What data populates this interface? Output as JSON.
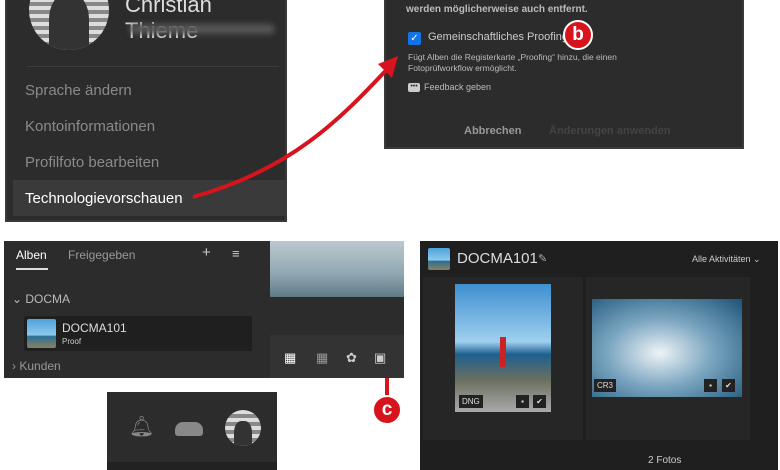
{
  "profile": {
    "name": "Christian Thieme",
    "menu": [
      "Sprache ändern",
      "Kontoinformationen",
      "Profilfoto bearbeiten",
      "Technologievorschauen"
    ]
  },
  "dialog": {
    "top_text": "werden möglicherweise auch entfernt.",
    "checkbox_label": "Gemeinschaftliches Proofing",
    "description": "Fügt Alben die Registerkarte „Proofing“ hinzu, die einen Fotoprüfworkflow ermöglicht.",
    "feedback": "Feedback geben",
    "cancel": "Abbrechen",
    "apply": "Änderungen anwenden"
  },
  "badges": {
    "b": "b",
    "c": "c"
  },
  "albums": {
    "tabs": [
      "Alben",
      "Freigegeben"
    ],
    "add": "+",
    "sort": "≡",
    "group": "DOCMA",
    "album_name": "DOCMA101",
    "album_sub": "Proof",
    "group2": "Kunden"
  },
  "view": {
    "title": "DOCMA101",
    "filter": "Alle Aktivitäten",
    "photos": [
      {
        "type": "DNG"
      },
      {
        "type": "CR3"
      }
    ],
    "count": "2 Fotos"
  },
  "colors": {
    "accent": "#d7141d",
    "checkbox": "#1473e6"
  }
}
